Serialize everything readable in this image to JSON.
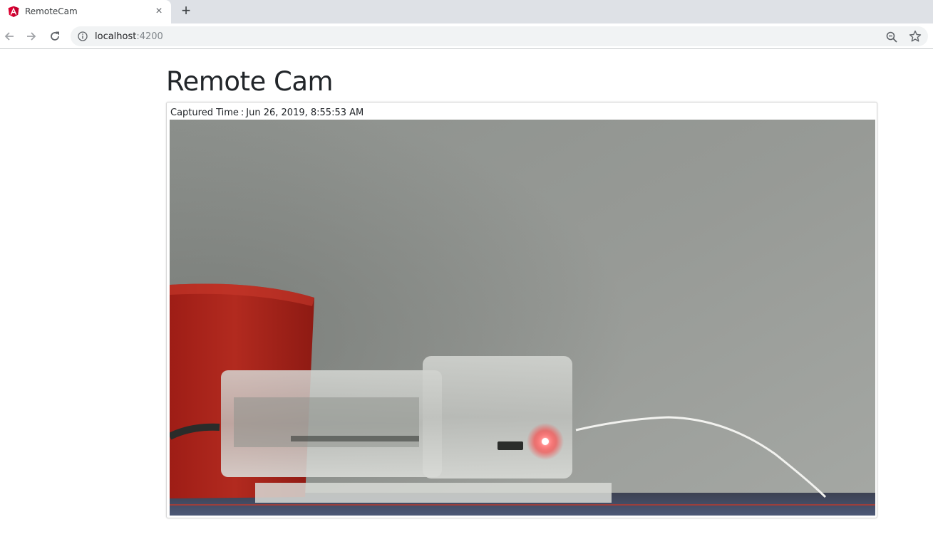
{
  "browser": {
    "tab_title": "RemoteCam",
    "tab_close": "×",
    "new_tab": "+",
    "url_host": "localhost",
    "url_port": ":4200"
  },
  "page": {
    "title": "Remote Cam",
    "captured_label": "Captured Time",
    "captured_sep": ":",
    "captured_time": "Jun 26, 2019, 8:55:53 AM"
  },
  "colors": {
    "angular_red": "#dd0031",
    "tabstrip": "#dee1e6",
    "omnibox": "#f1f3f4"
  }
}
